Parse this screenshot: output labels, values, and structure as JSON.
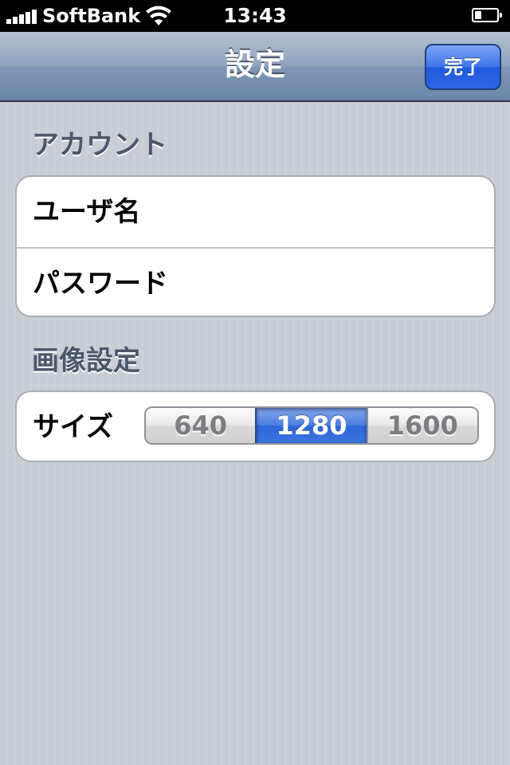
{
  "status_bar": {
    "carrier": "SoftBank",
    "time": "13:43",
    "signal_bars": 5,
    "battery_level": 0.3
  },
  "nav": {
    "title": "設定",
    "done_label": "完了"
  },
  "sections": {
    "account": {
      "header": "アカウント",
      "username_label": "ユーザ名",
      "password_label": "パスワード"
    },
    "image": {
      "header": "画像設定",
      "size_label": "サイズ",
      "size_options": [
        "640",
        "1280",
        "1600"
      ],
      "selected_size": "1280"
    }
  },
  "colors": {
    "nav_gradient_top": "#b4c2d3",
    "nav_gradient_bottom": "#6d87a8",
    "done_button_blue": "#2a66e6",
    "segment_selected_blue": "#3a74df",
    "section_header_text": "#4c566c",
    "background": "#c7ccd5"
  },
  "icons": {
    "signal": "signal-bars-icon",
    "wifi": "wifi-icon",
    "battery": "battery-icon"
  }
}
